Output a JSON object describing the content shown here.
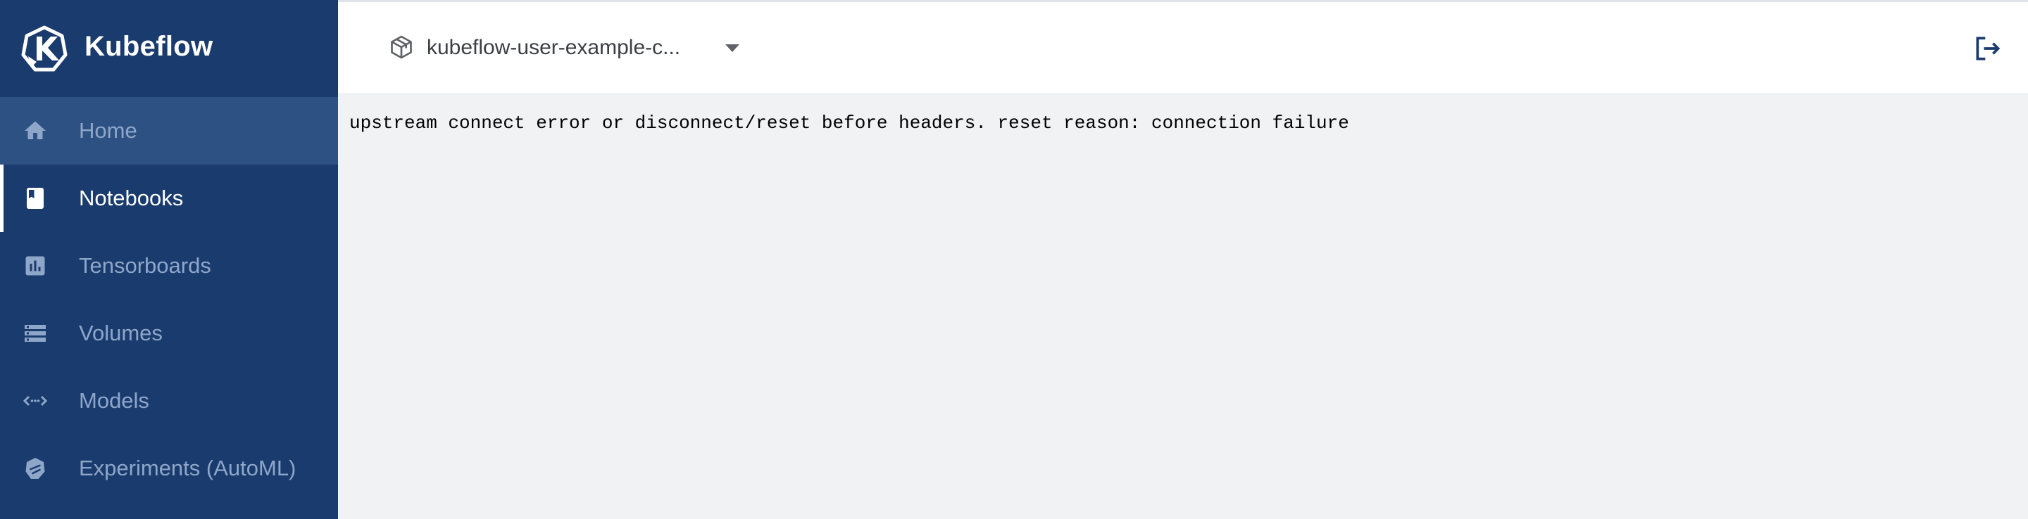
{
  "app": {
    "title": "Kubeflow"
  },
  "sidebar": {
    "items": [
      {
        "label": "Home",
        "icon": "home-icon",
        "state": "hover"
      },
      {
        "label": "Notebooks",
        "icon": "notebook-icon",
        "state": "active"
      },
      {
        "label": "Tensorboards",
        "icon": "bar-chart-icon",
        "state": "normal"
      },
      {
        "label": "Volumes",
        "icon": "storage-icon",
        "state": "normal"
      },
      {
        "label": "Models",
        "icon": "code-arrows-icon",
        "state": "normal"
      },
      {
        "label": "Experiments (AutoML)",
        "icon": "experiment-icon",
        "state": "normal"
      }
    ]
  },
  "header": {
    "namespace": "kubeflow-user-example-c...",
    "namespace_icon": "cube-icon",
    "logout_icon": "logout-icon"
  },
  "main": {
    "error_message": "upstream connect error or disconnect/reset before headers. reset reason: connection failure"
  },
  "colors": {
    "sidebar_bg": "#1a3b6e",
    "sidebar_hover": "#2e5184",
    "sidebar_text": "#8ea6c8",
    "active_text": "#ffffff",
    "content_bg": "#f1f2f4",
    "accent": "#1a3b6e"
  }
}
